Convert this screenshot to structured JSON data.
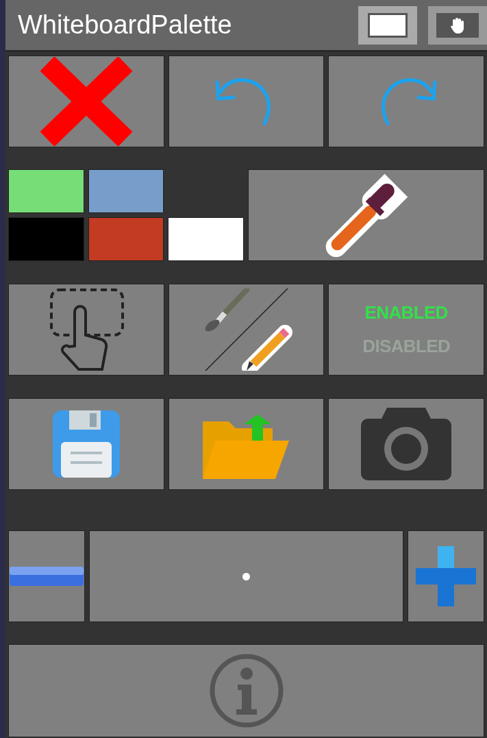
{
  "window": {
    "title": "WhiteboardPalette"
  },
  "title_buttons": [
    {
      "kind": "rect",
      "selected": true
    },
    {
      "kind": "hand",
      "selected": false
    }
  ],
  "actions": [
    {
      "kind": "clear"
    },
    {
      "kind": "undo"
    },
    {
      "kind": "redo"
    }
  ],
  "swatches": [
    {
      "kind": "swatch",
      "color": "#77dd77"
    },
    {
      "kind": "swatch",
      "color": "#779ecb"
    },
    {
      "kind": "empty"
    },
    {
      "kind": "swatch",
      "color": "#000000"
    },
    {
      "kind": "swatch",
      "color": "#c23b22"
    },
    {
      "kind": "swatch",
      "color": "#ffffff"
    }
  ],
  "mode_toggle": {
    "options": [
      {
        "label": "ENABLED",
        "selected": true
      },
      {
        "label": "DISABLED",
        "selected": false
      }
    ]
  }
}
